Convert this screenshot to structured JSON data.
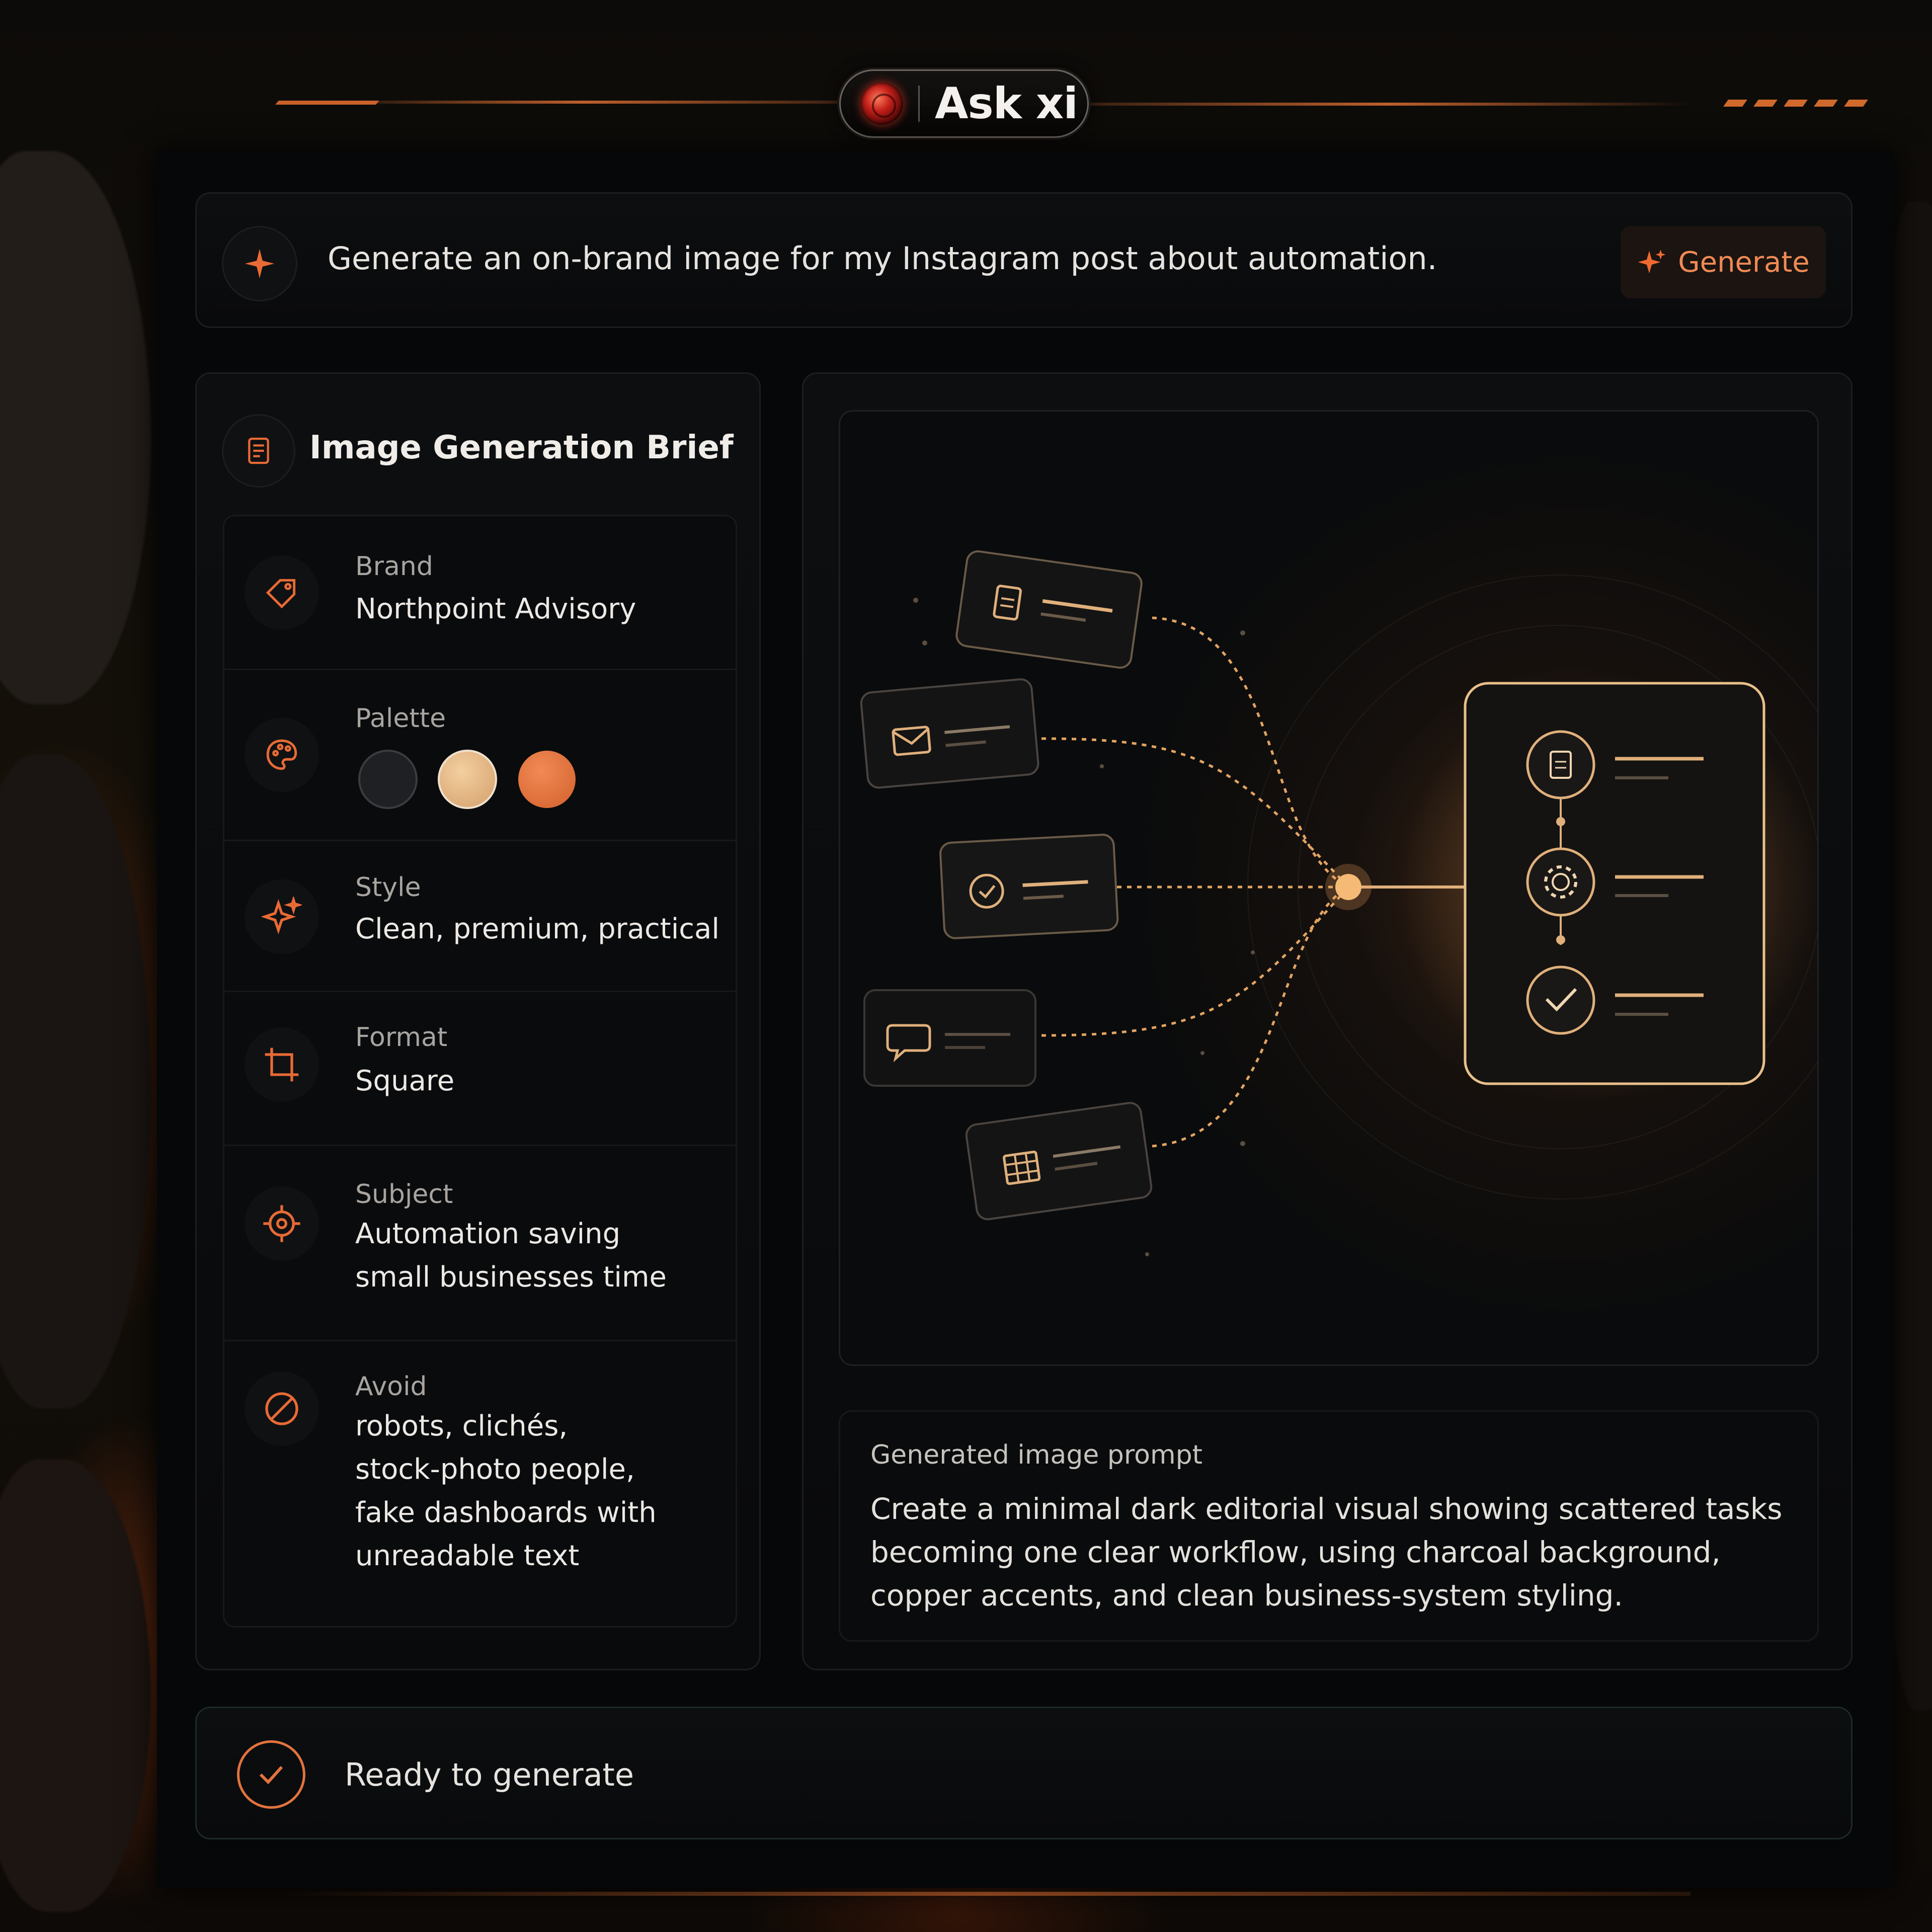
{
  "header": {
    "title": "Ask xi"
  },
  "prompt": {
    "text": "Generate an on-brand image for my Instagram post about automation.",
    "generate_label": "Generate"
  },
  "brief": {
    "title": "Image Generation Brief",
    "brand": {
      "label": "Brand",
      "value": "Northpoint Advisory"
    },
    "palette": {
      "label": "Palette",
      "colors": [
        "#1f2023",
        "#e0b07c",
        "#e2733e"
      ]
    },
    "style": {
      "label": "Style",
      "value": "Clean, premium, practical"
    },
    "format": {
      "label": "Format",
      "value": "Square"
    },
    "subject": {
      "label": "Subject",
      "value": "Automation saving small businesses time"
    },
    "avoid": {
      "label": "Avoid",
      "value": "robots, clichés, stock-photo people, fake dashboards with unreadable text"
    }
  },
  "generated_prompt": {
    "label": "Generated image prompt",
    "text": "Create a minimal dark editorial visual showing scattered tasks becoming one clear workflow, using charcoal background, copper accents, and clean business-system styling."
  },
  "status": {
    "text": "Ready to generate"
  },
  "colors": {
    "accent": "#e2733e",
    "gold": "#e0b07c",
    "background": "#060708"
  }
}
